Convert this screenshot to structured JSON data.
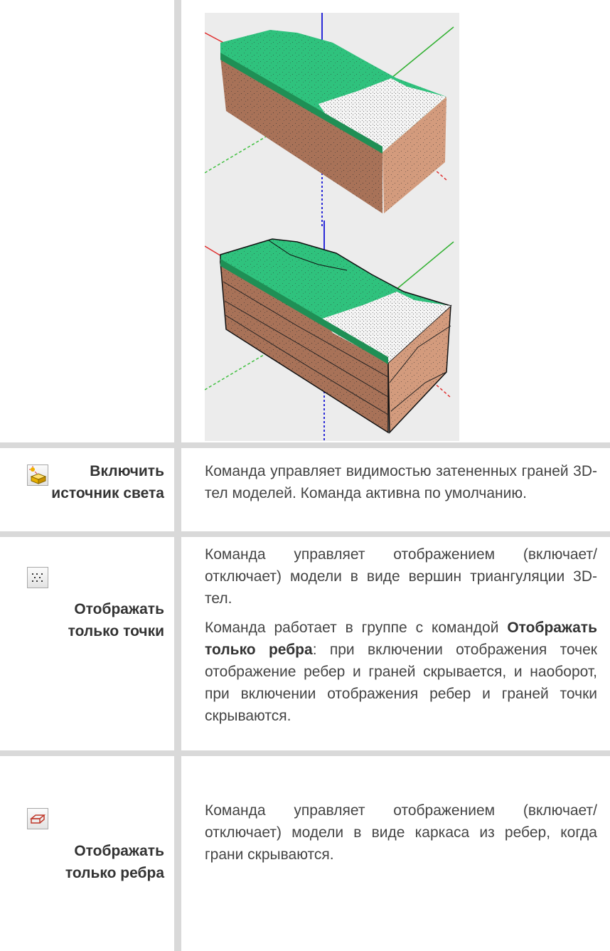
{
  "commands": [
    {
      "id": "light",
      "icon": "light-source-icon",
      "title_line1": "Включить",
      "title_line2": "источник света",
      "desc_p1": "Команда управляет видимостью затененных граней 3D-тел моделей. Команда активна по умолчанию."
    },
    {
      "id": "points",
      "icon": "points-icon",
      "title_line1": "Отображать",
      "title_line2": "только точки",
      "desc_p1": "Команда управляет отображением (включает/ отключает) модели в виде вершин триангуляции 3D-тел.",
      "desc_p2_pre": "Команда работает в группе с командой ",
      "desc_p2_bold": "Отображать только ребра",
      "desc_p2_post": ": при включении отображения точек отображение ребер и граней скрывается, и наоборот, при включении отображения ребер и граней точки скрываются."
    },
    {
      "id": "edges",
      "icon": "wireframe-icon",
      "title_line1": "Отображать",
      "title_line2": "только ребра",
      "desc_p1": "Команда управляет отображением (включает/ отключает) модели в виде каркаса из ребер, когда грани скрываются."
    }
  ],
  "colors": {
    "table_border": "#d9d9d9",
    "text": "#444444",
    "terrain_green": "#2ec47f",
    "soil_brown": "#c28a6c",
    "snow_white": "#f4f4f4",
    "axis_x": "#e02020",
    "axis_y": "#20b020",
    "axis_z": "#2020d0"
  }
}
